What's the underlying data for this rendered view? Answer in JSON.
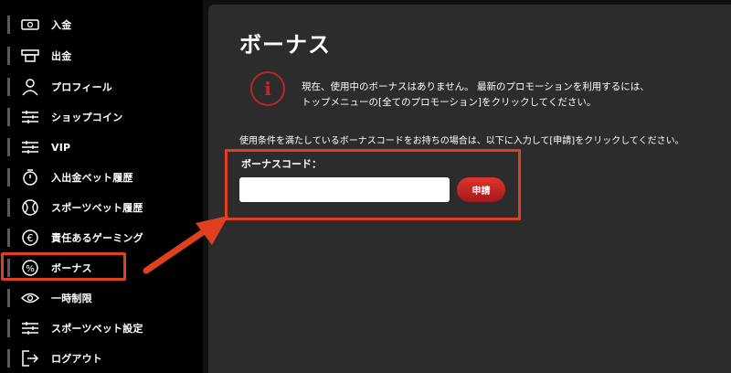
{
  "sidebar": {
    "items": [
      {
        "label": "入金",
        "icon": "deposit-icon"
      },
      {
        "label": "出金",
        "icon": "withdraw-icon"
      },
      {
        "label": "プロフィール",
        "icon": "user-icon"
      },
      {
        "label": "ショップコイン",
        "icon": "sliders-icon"
      },
      {
        "label": "VIP",
        "icon": "sliders-icon"
      },
      {
        "label": "入出金ベット履歴",
        "icon": "stopwatch-icon"
      },
      {
        "label": "スポーツベット履歴",
        "icon": "ball-icon"
      },
      {
        "label": "責任あるゲーミング",
        "icon": "euro-icon"
      },
      {
        "label": "ボーナス",
        "icon": "percent-icon",
        "active": true
      },
      {
        "label": "一時制限",
        "icon": "eye-icon"
      },
      {
        "label": "スポーツベット設定",
        "icon": "sliders-icon"
      },
      {
        "label": "ログアウト",
        "icon": "logout-icon"
      }
    ]
  },
  "main": {
    "title": "ボーナス",
    "notice_line1": "現在、使用中のボーナスはありません。 最新のプロモーションを利用するには、",
    "notice_line2": "トップメニューの[全てのプロモーション]をクリックしてください。",
    "condition_text": "使用条件を満たしているボーナスコードをお持ちの場合は、以下に入力して[申請]をクリックしてください。",
    "code_label": "ボーナスコード：",
    "code_value": "",
    "apply_label": "申請"
  },
  "colors": {
    "highlight": "#e0401f",
    "accent": "#c8262c",
    "panel": "#2c2c2c"
  }
}
